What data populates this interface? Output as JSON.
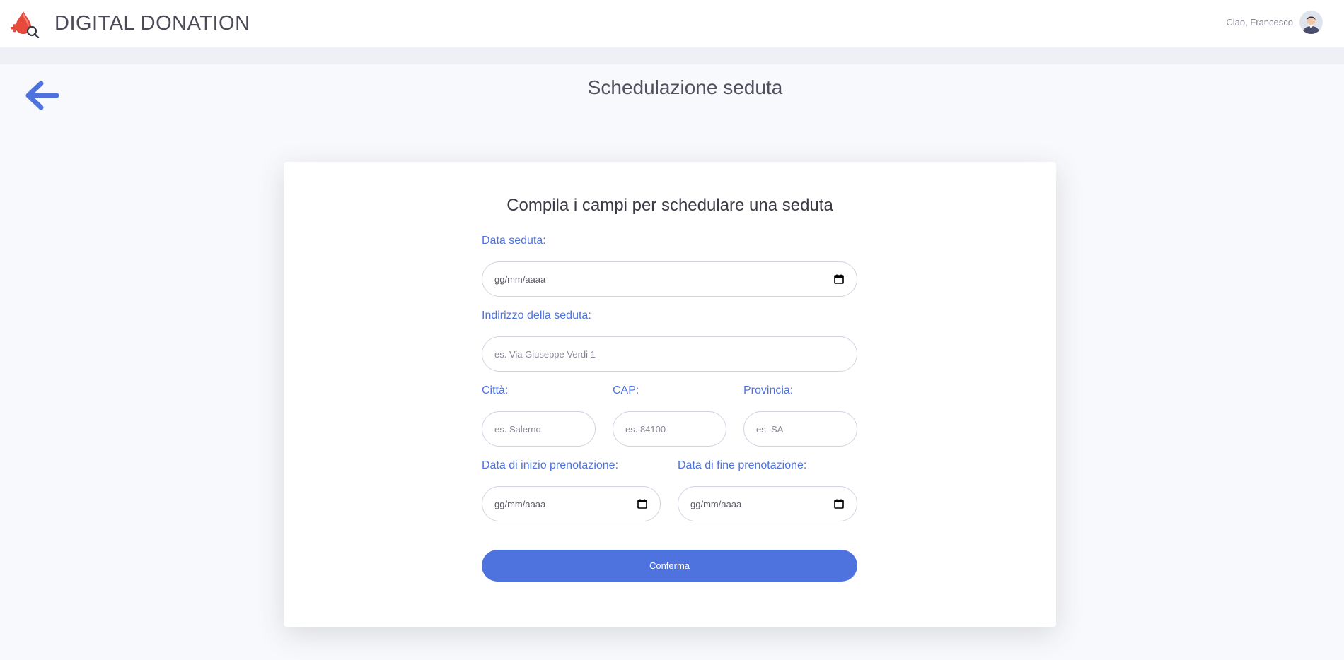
{
  "header": {
    "brand_name": "DIGITAL DONATION",
    "logo_icon": "blood-drop-search-logo",
    "greeting": "Ciao, Francesco",
    "avatar_icon": "user-avatar-icon"
  },
  "page": {
    "title": "Schedulazione seduta",
    "back_icon": "arrow-left-icon"
  },
  "form": {
    "heading": "Compila i campi per schedulare una seduta",
    "date_label": "Data seduta:",
    "date_value": "gg/mm/aaaa",
    "address_label": "Indirizzo della seduta:",
    "address_placeholder": "es. Via Giuseppe Verdi 1",
    "city_label": "Città:",
    "city_placeholder": "es. Salerno",
    "cap_label": "CAP:",
    "cap_placeholder": "es. 84100",
    "province_label": "Provincia:",
    "province_placeholder": "es. SA",
    "start_label": "Data di inizio prenotazione:",
    "start_value": "gg/mm/aaaa",
    "end_label": "Data di fine prenotazione:",
    "end_value": "gg/mm/aaaa",
    "confirm_label": "Conferma"
  },
  "colors": {
    "accent": "#4e73df",
    "logo_red": "#e74a3b",
    "background": "#f8f9fc"
  }
}
